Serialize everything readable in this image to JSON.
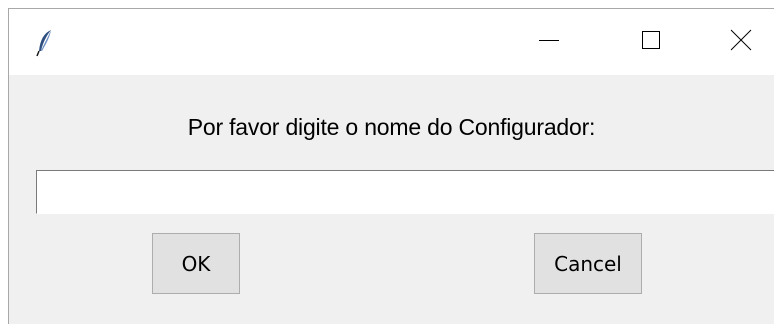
{
  "window": {
    "icon": "feather-icon",
    "controls": {
      "minimize": "minimize-icon",
      "maximize": "maximize-icon",
      "close": "close-icon"
    }
  },
  "dialog": {
    "prompt": "Por favor digite o nome do Configurador:",
    "input_value": "",
    "ok_label": "OK",
    "cancel_label": "Cancel"
  },
  "colors": {
    "titlebar_bg": "#ffffff",
    "client_bg": "#f0f0f0",
    "button_bg": "#e1e1e1",
    "button_border": "#adadad"
  }
}
